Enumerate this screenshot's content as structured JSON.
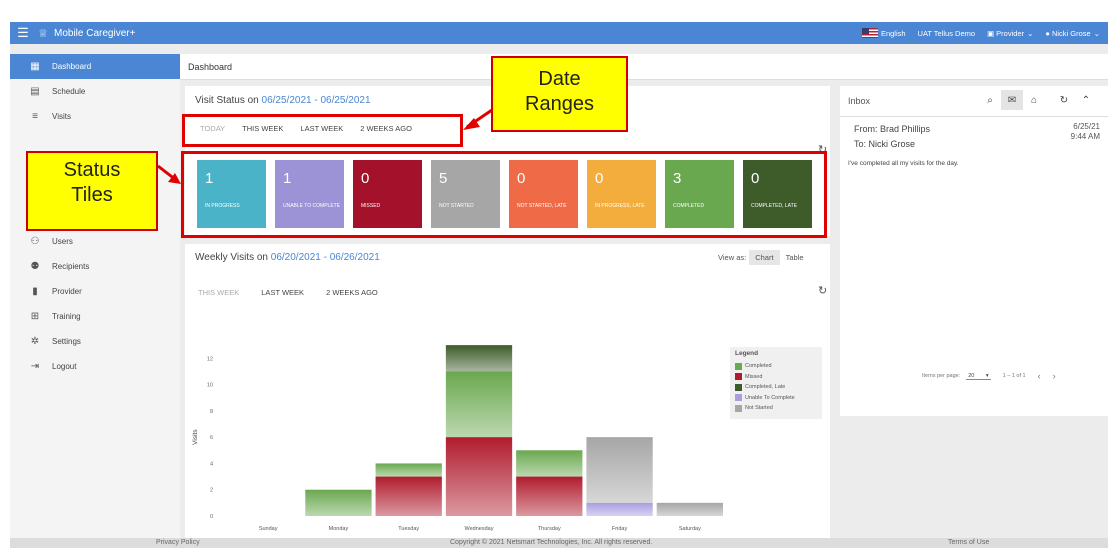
{
  "topbar": {
    "app_title": "Mobile Caregiver+",
    "language": "English",
    "environment": "UAT Tellus Demo",
    "role": "Provider",
    "user": "Nicki Grose"
  },
  "header": {
    "title": "Dashboard"
  },
  "sidebar": {
    "items": [
      {
        "label": "Dashboard",
        "icon": "dashboard-icon",
        "active": true
      },
      {
        "label": "Schedule",
        "icon": "calendar-icon",
        "active": false
      },
      {
        "label": "Visits",
        "icon": "filter-icon",
        "active": false
      },
      {
        "label": "Users",
        "icon": "users-icon",
        "active": false
      },
      {
        "label": "Recipients",
        "icon": "recipients-icon",
        "active": false
      },
      {
        "label": "Provider",
        "icon": "provider-icon",
        "active": false
      },
      {
        "label": "Training",
        "icon": "training-icon",
        "active": false
      },
      {
        "label": "Settings",
        "icon": "gear-icon",
        "active": false
      },
      {
        "label": "Logout",
        "icon": "logout-icon",
        "active": false
      }
    ]
  },
  "visit_status": {
    "title_prefix": "Visit Status on ",
    "date_range": "06/25/2021 - 06/25/2021",
    "tabs": [
      "TODAY",
      "THIS WEEK",
      "LAST WEEK",
      "2 WEEKS AGO"
    ],
    "tiles": [
      {
        "count": "1",
        "label": "IN PROGRESS",
        "color": "#4ab3c7"
      },
      {
        "count": "1",
        "label": "UNABLE TO COMPLETE",
        "color": "#9b93d6"
      },
      {
        "count": "0",
        "label": "MISSED",
        "color": "#a3122a"
      },
      {
        "count": "5",
        "label": "NOT STARTED",
        "color": "#a6a6a6"
      },
      {
        "count": "0",
        "label": "NOT STARTED, LATE",
        "color": "#ef6a47"
      },
      {
        "count": "0",
        "label": "IN PROGRESS, LATE",
        "color": "#f2ad3c"
      },
      {
        "count": "3",
        "label": "COMPLETED",
        "color": "#6aa84f"
      },
      {
        "count": "0",
        "label": "COMPLETED, LATE",
        "color": "#3d5c2a"
      }
    ]
  },
  "weekly_visits": {
    "title_prefix": "Weekly Visits on ",
    "date_range": "06/20/2021 - 06/26/2021",
    "view_as_label": "View as:",
    "view_options": [
      "Chart",
      "Table"
    ],
    "tabs": [
      "THIS WEEK",
      "LAST WEEK",
      "2 WEEKS AGO"
    ]
  },
  "chart_data": {
    "type": "bar",
    "stacked": true,
    "categories": [
      "Sunday",
      "Monday",
      "Tuesday",
      "Wednesday",
      "Thursday",
      "Friday",
      "Saturday"
    ],
    "ylabel": "Visits",
    "ylim": [
      0,
      14
    ],
    "yticks": [
      0,
      2,
      4,
      6,
      8,
      10,
      12
    ],
    "series": [
      {
        "name": "Unable To Complete",
        "color": "#a89ee0",
        "values": [
          0,
          0,
          0,
          0,
          0,
          1,
          0
        ]
      },
      {
        "name": "Missed",
        "color": "#b01c2e",
        "values": [
          0,
          0,
          3,
          6,
          3,
          0,
          0
        ]
      },
      {
        "name": "Not Started",
        "color": "#a6a6a6",
        "values": [
          0,
          0,
          0,
          0,
          0,
          5,
          1
        ]
      },
      {
        "name": "Completed",
        "color": "#6aa84f",
        "values": [
          0,
          2,
          1,
          5,
          2,
          0,
          0
        ]
      },
      {
        "name": "Completed, Late",
        "color": "#3d5c2a",
        "values": [
          0,
          0,
          0,
          2,
          0,
          0,
          0
        ]
      }
    ],
    "legend": {
      "title": "Legend",
      "items": [
        {
          "name": "Completed",
          "color": "#6aa84f"
        },
        {
          "name": "Missed",
          "color": "#b01c2e"
        },
        {
          "name": "Completed, Late",
          "color": "#3d5c2a"
        },
        {
          "name": "Unable To Complete",
          "color": "#a89ee0"
        },
        {
          "name": "Not Started",
          "color": "#a6a6a6"
        }
      ],
      "position": "right"
    }
  },
  "inbox": {
    "title": "Inbox",
    "message": {
      "from": "From: Brad Phillips",
      "to": "To: Nicki Grose",
      "date": "6/25/21",
      "time": "9:44 AM",
      "body": "I've completed all my visits for the day."
    },
    "pager": {
      "label": "Items per page:",
      "per_page": "20",
      "range": "1 – 1 of 1"
    }
  },
  "footer": {
    "left": "Privacy Policy",
    "center": "Copyright © 2021 Netsmart Technologies, Inc. All rights reserved.",
    "right": "Terms of Use"
  },
  "annotations": {
    "date_ranges": "Date Ranges",
    "status_tiles": "Status Tiles"
  }
}
